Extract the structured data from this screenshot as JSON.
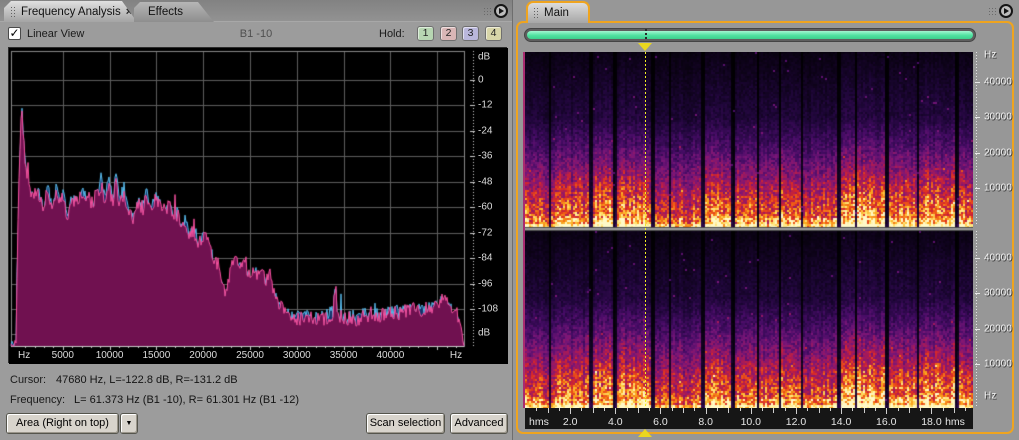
{
  "left_panel": {
    "tabs": [
      {
        "label": "Frequency Analysis",
        "close_glyph": "×"
      },
      {
        "label": "Effects"
      }
    ],
    "toolbar": {
      "linear_view_label": "Linear View",
      "linear_view_checked": true,
      "check_glyph": "✓",
      "note": "B1 -10",
      "hold_label": "Hold:",
      "hold_buttons": [
        {
          "label": "1",
          "bg": "#b7d6b2"
        },
        {
          "label": "2",
          "bg": "#d9b6b6"
        },
        {
          "label": "3",
          "bg": "#bab7dc"
        },
        {
          "label": "4",
          "bg": "#d8d5a8"
        }
      ]
    },
    "status": {
      "cursor_label": "Cursor:",
      "cursor_value": "47680 Hz, L=-122.8 dB, R=-131.2 dB",
      "frequency_label": "Frequency:",
      "frequency_value": "L= 61.373 Hz (B1 -10), R= 61.301 Hz (B1 -12)"
    },
    "controls": {
      "area_button": "Area (Right on top)",
      "dropdown_glyph": "▼",
      "scan_button": "Scan selection",
      "advanced_button": "Advanced"
    }
  },
  "right_panel": {
    "tab": {
      "label": "Main"
    },
    "colors": {
      "active_border": "#efa41f",
      "range_bar": "#4fe2a0",
      "cursor": "#f0ee24"
    }
  },
  "chart_data": [
    {
      "id": "frequency-analysis",
      "type": "area",
      "xlabel": "Hz",
      "ylabel": "dB",
      "x_ticks": [
        "Hz",
        "5000",
        "10000",
        "15000",
        "20000",
        "25000",
        "30000",
        "35000",
        "40000",
        "Hz"
      ],
      "y_ticks": [
        "dB",
        "0",
        "-12",
        "-24",
        "-36",
        "-48",
        "-60",
        "-72",
        "-84",
        "-96",
        "-108",
        "dB"
      ],
      "x_range_hz": [
        0,
        48000
      ],
      "y_range_db": [
        -126,
        6
      ],
      "grid": true,
      "draw_order_note": "Area (Right on top)",
      "series": [
        {
          "name": "Left",
          "color": "#58bbec",
          "fill": "#15316a",
          "points": [
            [
              0,
              -126
            ],
            [
              250,
              -70
            ],
            [
              450,
              -34
            ],
            [
              650,
              -15
            ],
            [
              800,
              -26
            ],
            [
              1000,
              -42
            ],
            [
              1400,
              -52
            ],
            [
              1900,
              -57
            ],
            [
              2400,
              -51
            ],
            [
              2900,
              -63
            ],
            [
              3400,
              -50
            ],
            [
              3900,
              -61
            ],
            [
              4300,
              -49
            ],
            [
              4700,
              -59
            ],
            [
              5100,
              -54
            ],
            [
              5500,
              -68
            ],
            [
              5900,
              -56
            ],
            [
              6600,
              -59
            ],
            [
              7100,
              -52
            ],
            [
              7600,
              -56
            ],
            [
              8100,
              -60
            ],
            [
              8600,
              -52
            ],
            [
              9100,
              -47
            ],
            [
              9500,
              -55
            ],
            [
              9900,
              -45
            ],
            [
              10300,
              -57
            ],
            [
              10700,
              -44
            ],
            [
              11100,
              -57
            ],
            [
              11600,
              -50
            ],
            [
              12100,
              -63
            ],
            [
              12600,
              -68
            ],
            [
              13100,
              -55
            ],
            [
              13500,
              -61
            ],
            [
              13900,
              -53
            ],
            [
              14400,
              -62
            ],
            [
              14900,
              -55
            ],
            [
              15400,
              -59
            ],
            [
              15900,
              -63
            ],
            [
              16400,
              -58
            ],
            [
              16900,
              -67
            ],
            [
              17300,
              -60
            ],
            [
              17700,
              -71
            ],
            [
              18100,
              -64
            ],
            [
              18500,
              -75
            ],
            [
              18900,
              -68
            ],
            [
              19500,
              -78
            ],
            [
              20100,
              -74
            ],
            [
              20700,
              -81
            ],
            [
              21300,
              -87
            ],
            [
              21900,
              -97
            ],
            [
              22300,
              -102
            ],
            [
              22700,
              -96
            ],
            [
              23100,
              -90
            ],
            [
              23500,
              -86
            ],
            [
              23900,
              -88
            ],
            [
              24300,
              -86
            ],
            [
              24700,
              -93
            ],
            [
              25100,
              -96
            ],
            [
              25500,
              -90
            ],
            [
              25900,
              -95
            ],
            [
              26300,
              -91
            ],
            [
              26700,
              -96
            ],
            [
              27100,
              -93
            ],
            [
              27500,
              -100
            ],
            [
              27900,
              -104
            ],
            [
              28500,
              -109
            ],
            [
              29100,
              -113
            ],
            [
              30000,
              -112
            ],
            [
              31000,
              -112
            ],
            [
              32000,
              -113
            ],
            [
              33000,
              -112
            ],
            [
              33900,
              -109
            ],
            [
              34100,
              -97
            ],
            [
              34400,
              -112
            ],
            [
              35000,
              -113
            ],
            [
              36000,
              -112
            ],
            [
              37000,
              -111
            ],
            [
              38000,
              -111
            ],
            [
              39000,
              -110
            ],
            [
              40000,
              -110
            ],
            [
              41000,
              -109
            ],
            [
              42000,
              -109
            ],
            [
              43000,
              -108
            ],
            [
              44000,
              -108
            ],
            [
              45000,
              -107
            ],
            [
              45700,
              -104
            ],
            [
              46300,
              -108
            ],
            [
              47200,
              -112
            ],
            [
              47800,
              -126
            ]
          ]
        },
        {
          "name": "Right",
          "color": "#f4509e",
          "fill": "#701150",
          "points": [
            [
              0,
              -126
            ],
            [
              220,
              -66
            ],
            [
              420,
              -30
            ],
            [
              600,
              -13
            ],
            [
              780,
              -24
            ],
            [
              980,
              -40
            ],
            [
              1400,
              -50
            ],
            [
              1900,
              -55
            ],
            [
              2400,
              -53
            ],
            [
              2900,
              -60
            ],
            [
              3400,
              -52
            ],
            [
              3900,
              -63
            ],
            [
              4300,
              -51
            ],
            [
              4700,
              -57
            ],
            [
              5100,
              -56
            ],
            [
              5500,
              -66
            ],
            [
              5900,
              -58
            ],
            [
              6600,
              -57
            ],
            [
              7100,
              -54
            ],
            [
              7600,
              -54
            ],
            [
              8100,
              -58
            ],
            [
              8600,
              -54
            ],
            [
              9100,
              -50
            ],
            [
              9500,
              -57
            ],
            [
              9900,
              -49
            ],
            [
              10300,
              -58
            ],
            [
              10700,
              -48
            ],
            [
              11100,
              -59
            ],
            [
              11600,
              -53
            ],
            [
              12100,
              -64
            ],
            [
              12600,
              -66
            ],
            [
              13100,
              -57
            ],
            [
              13500,
              -62
            ],
            [
              13900,
              -55
            ],
            [
              14400,
              -60
            ],
            [
              14900,
              -57
            ],
            [
              15400,
              -57
            ],
            [
              15900,
              -61
            ],
            [
              16400,
              -60
            ],
            [
              16900,
              -64
            ],
            [
              17300,
              -63
            ],
            [
              17700,
              -68
            ],
            [
              18100,
              -67
            ],
            [
              18500,
              -72
            ],
            [
              18900,
              -71
            ],
            [
              19500,
              -76
            ],
            [
              20100,
              -73
            ],
            [
              20700,
              -78
            ],
            [
              21300,
              -85
            ],
            [
              21900,
              -95
            ],
            [
              22300,
              -100
            ],
            [
              22700,
              -94
            ],
            [
              23100,
              -88
            ],
            [
              23500,
              -85
            ],
            [
              23900,
              -87
            ],
            [
              24300,
              -85
            ],
            [
              24700,
              -91
            ],
            [
              25100,
              -94
            ],
            [
              25500,
              -89
            ],
            [
              25900,
              -93
            ],
            [
              26300,
              -90
            ],
            [
              26700,
              -95
            ],
            [
              27100,
              -92
            ],
            [
              27500,
              -98
            ],
            [
              27900,
              -103
            ],
            [
              28500,
              -108
            ],
            [
              29100,
              -112
            ],
            [
              30000,
              -113
            ],
            [
              31000,
              -112
            ],
            [
              32000,
              -112
            ],
            [
              33000,
              -113
            ],
            [
              33900,
              -110
            ],
            [
              34100,
              -96
            ],
            [
              34400,
              -111
            ],
            [
              35000,
              -112
            ],
            [
              36000,
              -113
            ],
            [
              37000,
              -112
            ],
            [
              38000,
              -110
            ],
            [
              39000,
              -111
            ],
            [
              40000,
              -109
            ],
            [
              41000,
              -110
            ],
            [
              42000,
              -108
            ],
            [
              43000,
              -109
            ],
            [
              44000,
              -107
            ],
            [
              45000,
              -106
            ],
            [
              45700,
              -102
            ],
            [
              46300,
              -107
            ],
            [
              47200,
              -111
            ],
            [
              47800,
              -126
            ]
          ]
        }
      ]
    },
    {
      "id": "spectrogram-main",
      "type": "heatmap",
      "channels": [
        "left",
        "right"
      ],
      "x_axis": {
        "unit": "hms",
        "ticks": [
          "hms",
          "2.0",
          "4.0",
          "6.0",
          "8.0",
          "10.0",
          "12.0",
          "14.0",
          "16.0",
          "18.0",
          "hms"
        ],
        "range_s": [
          0,
          19.8
        ]
      },
      "y_axis": {
        "unit": "Hz",
        "ticks_top_channel": [
          "Hz",
          "40000",
          "30000",
          "20000",
          "10000"
        ],
        "ticks_bottom_channel": [
          "40000",
          "30000",
          "20000",
          "10000",
          "Hz"
        ],
        "range_hz": [
          0,
          48000
        ]
      },
      "cursor_time_s": 5.3,
      "palette": [
        "#000000",
        "#1e0638",
        "#460c66",
        "#791678",
        "#a81a58",
        "#d82828",
        "#f05c14",
        "#fbab1e",
        "#ffe06a",
        "#fff9c8"
      ],
      "description": "stereo spectrogram: energy concentrated below ~12 kHz, bright band below ~2 kHz, bursts separated by short silences"
    }
  ]
}
